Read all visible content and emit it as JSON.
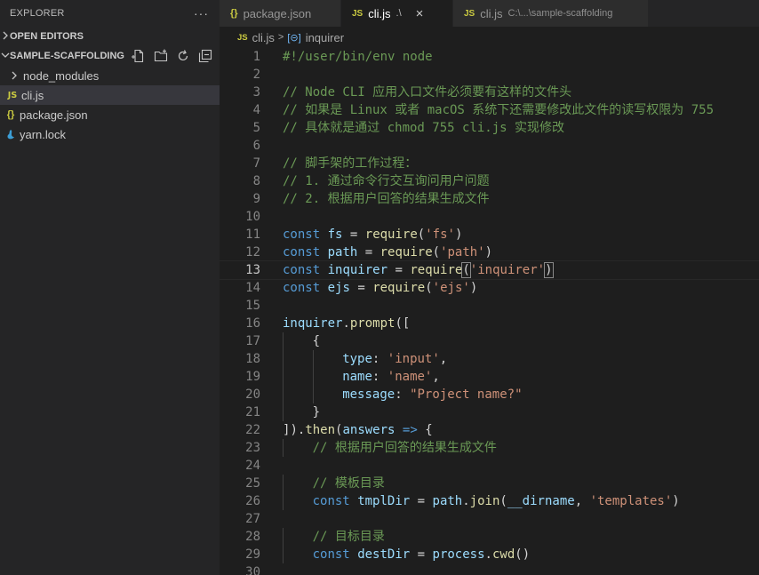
{
  "sidebar": {
    "header": "EXPLORER",
    "more": "···",
    "open_editors": "OPEN EDITORS",
    "folder": "SAMPLE-SCAFFOLDING",
    "items": [
      {
        "label": "node_modules",
        "icon": "chevron-right-icon"
      },
      {
        "label": "cli.js",
        "icon": "js-file-icon"
      },
      {
        "label": "package.json",
        "icon": "json-file-icon"
      },
      {
        "label": "yarn.lock",
        "icon": "yarn-file-icon"
      }
    ]
  },
  "tabs": [
    {
      "icon": "{}",
      "label": "package.json",
      "desc": ""
    },
    {
      "icon": "JS",
      "label": "cli.js",
      "desc": ".\\",
      "close": "×"
    },
    {
      "icon": "JS",
      "label": "cli.js",
      "desc": "C:\\...\\sample-scaffolding"
    }
  ],
  "breadcrumb": {
    "icon": "JS",
    "file": "cli.js",
    "separator": ">",
    "symbol_icon": "[⊝]",
    "symbol": "inquirer"
  },
  "editor": {
    "active_line": 13,
    "lines": [
      {
        "n": "1",
        "t": "#!/user/bin/env node"
      },
      {
        "n": "2",
        "t": ""
      },
      {
        "n": "3",
        "t": "// Node CLI 应用入口文件必须要有这样的文件头"
      },
      {
        "n": "4",
        "t": "// 如果是 Linux 或者 macOS 系统下还需要修改此文件的读写权限为 755"
      },
      {
        "n": "5",
        "t": "// 具体就是通过 chmod 755 cli.js 实现修改"
      },
      {
        "n": "6",
        "t": ""
      },
      {
        "n": "7",
        "t": "// 脚手架的工作过程："
      },
      {
        "n": "8",
        "t": "// 1. 通过命令行交互询问用户问题"
      },
      {
        "n": "9",
        "t": "// 2. 根据用户回答的结果生成文件"
      },
      {
        "n": "10",
        "t": ""
      },
      {
        "n": "11",
        "t": "const fs = require('fs')"
      },
      {
        "n": "12",
        "t": "const path = require('path')"
      },
      {
        "n": "13",
        "t": "const inquirer = require('inquirer')"
      },
      {
        "n": "14",
        "t": "const ejs = require('ejs')"
      },
      {
        "n": "15",
        "t": ""
      },
      {
        "n": "16",
        "t": "inquirer.prompt(["
      },
      {
        "n": "17",
        "t": "{"
      },
      {
        "n": "18",
        "t": "type: 'input',"
      },
      {
        "n": "19",
        "t": "name: 'name',"
      },
      {
        "n": "20",
        "t": "message: \"Project name?\""
      },
      {
        "n": "21",
        "t": "}"
      },
      {
        "n": "22",
        "t": "]).then(answers => {"
      },
      {
        "n": "23",
        "t": "// 根据用户回答的结果生成文件"
      },
      {
        "n": "24",
        "t": ""
      },
      {
        "n": "25",
        "t": "// 模板目录"
      },
      {
        "n": "26",
        "t": "const tmplDir = path.join(__dirname, 'templates')"
      },
      {
        "n": "27",
        "t": ""
      },
      {
        "n": "28",
        "t": "// 目标目录"
      },
      {
        "n": "29",
        "t": "const destDir = process.cwd()"
      },
      {
        "n": "30",
        "t": ""
      }
    ]
  },
  "colors": {
    "keyword": "#569cd6",
    "variable": "#9cdcfe",
    "string": "#ce9178",
    "function": "#dcdcaa",
    "comment": "#6a9955",
    "editor_bg": "#1e1e1e",
    "sidebar_bg": "#252526"
  }
}
